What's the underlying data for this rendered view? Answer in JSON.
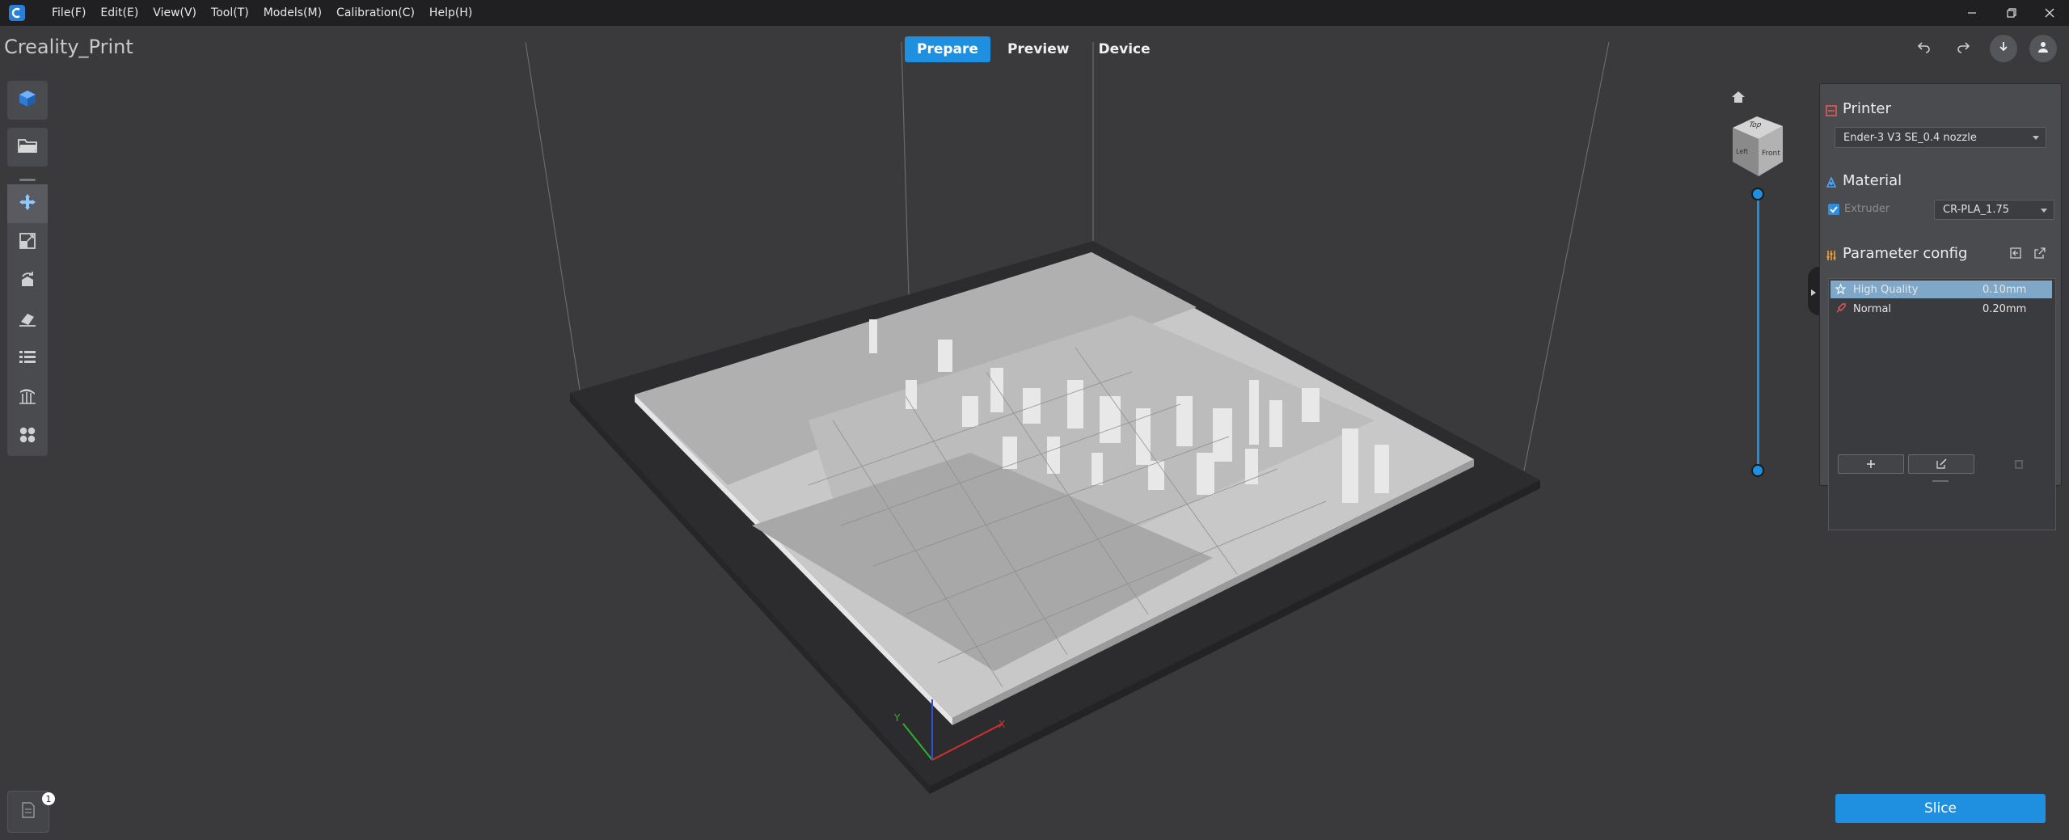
{
  "colors": {
    "accent": "#1f8fe0",
    "background": "#3a3a3c",
    "panel": "#4a4b4e",
    "printer_icon": "#e05a5a",
    "material_icon": "#4aa3ff",
    "param_icon": "#f0a030"
  },
  "titlebar": {
    "menu": [
      "File(F)",
      "Edit(E)",
      "View(V)",
      "Tool(T)",
      "Models(M)",
      "Calibration(C)",
      "Help(H)"
    ]
  },
  "app_title": "Creality_Print",
  "mode_tabs": [
    {
      "label": "Prepare",
      "active": true
    },
    {
      "label": "Preview",
      "active": false
    },
    {
      "label": "Device",
      "active": false
    }
  ],
  "view_cube": {
    "top": "Top",
    "front": "Front",
    "left": "Left"
  },
  "panel": {
    "printer": {
      "title": "Printer",
      "selected": "Ender-3 V3 SE_0.4 nozzle"
    },
    "material": {
      "title": "Material",
      "extruder_label": "Extruder",
      "extruder_checked": true,
      "selected": "CR-PLA_1.75"
    },
    "param": {
      "title": "Parameter config",
      "profiles": [
        {
          "name": "High Quality",
          "value": "0.10mm",
          "selected": true,
          "icon": "star-icon"
        },
        {
          "name": "Normal",
          "value": "0.20mm",
          "selected": false,
          "icon": "rocket-icon"
        }
      ]
    }
  },
  "slice_label": "Slice",
  "notification_count": "1"
}
